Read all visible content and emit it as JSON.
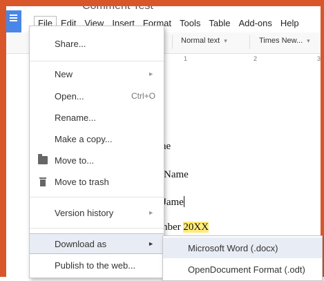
{
  "document": {
    "title_partial": "Comment Test"
  },
  "menubar": {
    "items": [
      "File",
      "Edit",
      "View",
      "Insert",
      "Format",
      "Tools",
      "Table",
      "Add-ons",
      "Help"
    ]
  },
  "toolbar": {
    "style_select": "Normal text",
    "font_select": "Times New..."
  },
  "ruler": {
    "ticks": [
      "1",
      "2",
      "3"
    ]
  },
  "doc_content": {
    "line1_visible": "ne",
    "line2_visible": "Name",
    "line3_visible": "Jame",
    "line4_prefix": "nber ",
    "line4_highlight": "20XX"
  },
  "file_menu": {
    "share": "Share...",
    "new": "New",
    "open": "Open...",
    "open_shortcut": "Ctrl+O",
    "rename": "Rename...",
    "make_copy": "Make a copy...",
    "move_to": "Move to...",
    "move_to_trash": "Move to trash",
    "version_history": "Version history",
    "download_as": "Download as",
    "publish": "Publish to the web...",
    "submenu_arrow": "►"
  },
  "download_submenu": {
    "items": [
      "Microsoft Word (.docx)",
      "OpenDocument Format (.odt)"
    ]
  },
  "icons": {
    "dropdown_arrow": "▾",
    "folder": "folder-icon",
    "trash": "trash-icon"
  },
  "colors": {
    "frame": "#d9562b",
    "docs_blue": "#4a86e8",
    "highlight_yellow": "#ffeb7a",
    "menu_selected": "#e8ecf4"
  }
}
